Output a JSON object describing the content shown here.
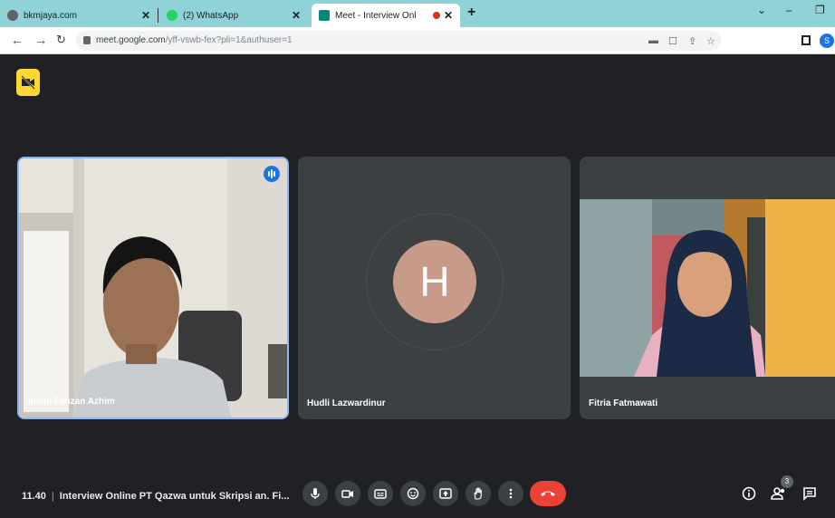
{
  "browser": {
    "tabs": [
      {
        "title": "bkmjaya.com",
        "active": false
      },
      {
        "title": "(2) WhatsApp",
        "active": false
      },
      {
        "title": "Meet - Interview Online PT Q",
        "active": true
      }
    ],
    "url_main": "meet.google.com",
    "url_path": "/yff-vswb-fex?pli=1&authuser=1",
    "profile_initial": "S"
  },
  "participants": [
    {
      "name": "Imam Fauzan Azhim",
      "speaking": true
    },
    {
      "name": "Hudli Lazwardinur",
      "avatar_letter": "H",
      "avatar_color": "#c89a8a"
    },
    {
      "name": "Fitria Fatmawati"
    }
  ],
  "meeting": {
    "time": "11.40",
    "separator": "|",
    "title": "Interview Online PT Qazwa untuk Skripsi an. Fi...",
    "participant_count": "3"
  },
  "colors": {
    "accent": "#8ab4f8",
    "end_call": "#ea4335",
    "badge": "#fdd835",
    "tabbar": "#8fd3d8"
  }
}
